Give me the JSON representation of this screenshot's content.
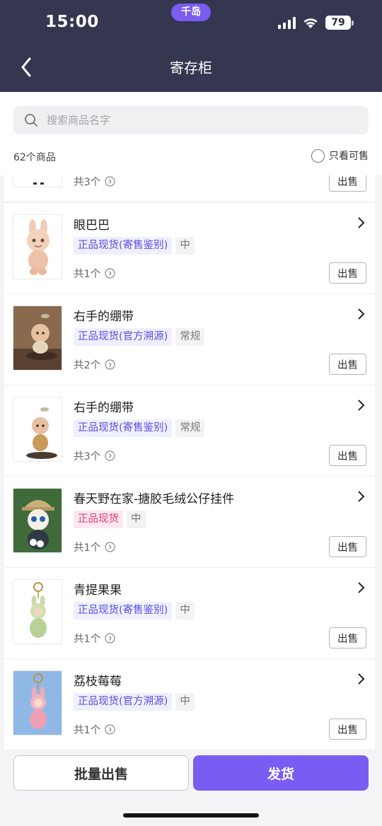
{
  "status": {
    "time": "15:00",
    "app_badge": "千岛",
    "battery": "79"
  },
  "nav": {
    "title": "寄存柜"
  },
  "search": {
    "placeholder": "搜索商品名字"
  },
  "summary": {
    "count_text": "62个商品",
    "filter_label": "只看可售"
  },
  "items": [
    {
      "name": "",
      "tags": [],
      "qty": "共3个",
      "sell": "出售"
    },
    {
      "name": "眼巴巴",
      "tags": [
        {
          "text": "正品现货(寄售鉴别)",
          "style": "blue"
        },
        {
          "text": "中",
          "style": "grey"
        }
      ],
      "qty": "共1个",
      "sell": "出售"
    },
    {
      "name": "右手的绷带",
      "tags": [
        {
          "text": "正品现货(官方溯源)",
          "style": "blue"
        },
        {
          "text": "常规",
          "style": "grey"
        }
      ],
      "qty": "共2个",
      "sell": "出售"
    },
    {
      "name": "右手的绷带",
      "tags": [
        {
          "text": "正品现货(寄售鉴别)",
          "style": "blue"
        },
        {
          "text": "常规",
          "style": "grey"
        }
      ],
      "qty": "共3个",
      "sell": "出售"
    },
    {
      "name": "春天野在家-搪胶毛绒公仔挂件",
      "tags": [
        {
          "text": "正品现货",
          "style": "pink"
        },
        {
          "text": "中",
          "style": "grey"
        }
      ],
      "qty": "共1个",
      "sell": "出售"
    },
    {
      "name": "青提果果",
      "tags": [
        {
          "text": "正品现货(寄售鉴别)",
          "style": "blue"
        },
        {
          "text": "中",
          "style": "grey"
        }
      ],
      "qty": "共1个",
      "sell": "出售"
    },
    {
      "name": "荔枝莓莓",
      "tags": [
        {
          "text": "正品现货(官方溯源)",
          "style": "blue"
        },
        {
          "text": "中",
          "style": "grey"
        }
      ],
      "qty": "共1个",
      "sell": "出售"
    }
  ],
  "bottom": {
    "batch_label": "批量出售",
    "ship_label": "发货"
  },
  "colors": {
    "header": "#353650",
    "accent": "#7b5cf2",
    "tag_blue": "#5a4ee0",
    "tag_pink": "#e0407a"
  }
}
